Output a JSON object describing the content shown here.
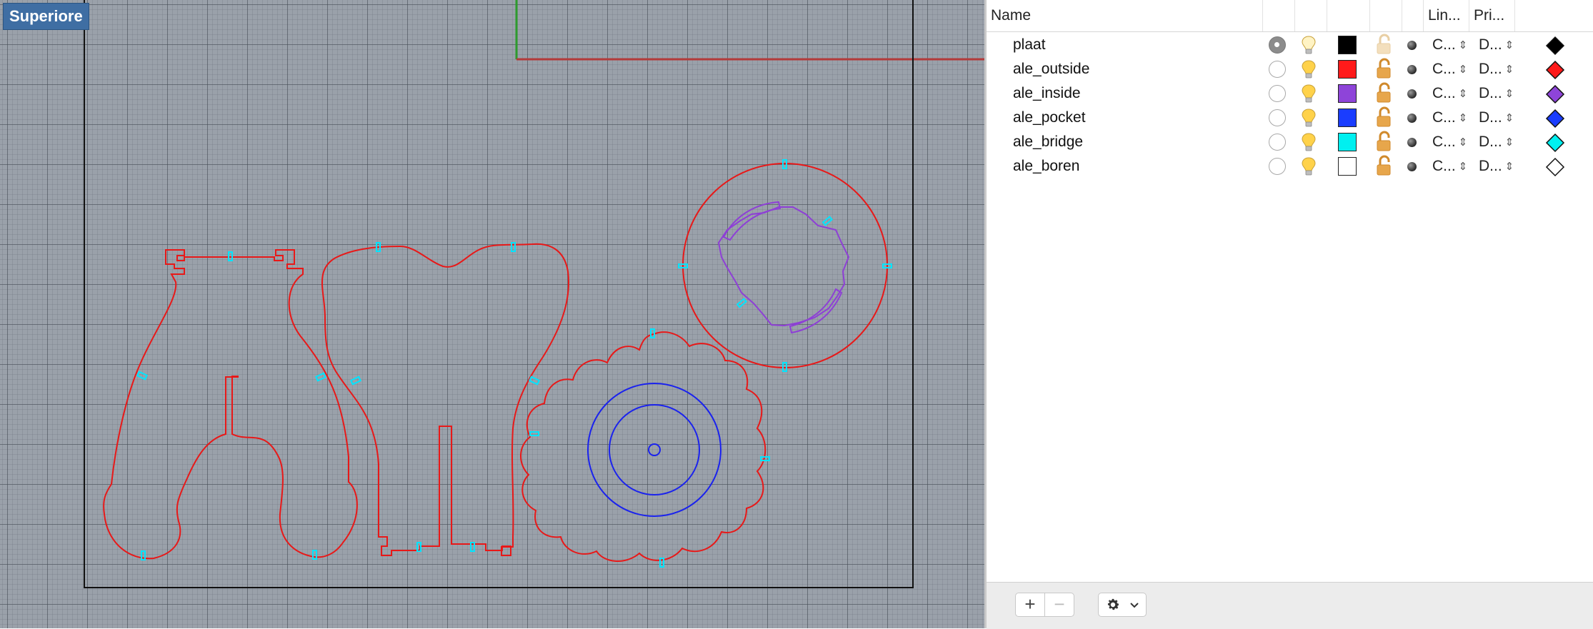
{
  "viewport": {
    "title": "Superiore"
  },
  "layers_panel": {
    "columns": {
      "name": "Name",
      "linetype": "Lin...",
      "print_width": "Pri..."
    },
    "layers": [
      {
        "name": "plaat",
        "current": true,
        "color": "#000000",
        "linetype": "C...",
        "print_width": "D...",
        "locked_faded": true
      },
      {
        "name": "ale_outside",
        "current": false,
        "color": "#ff1a1a",
        "linetype": "C...",
        "print_width": "D...",
        "locked_faded": false
      },
      {
        "name": "ale_inside",
        "current": false,
        "color": "#8e44d9",
        "linetype": "C...",
        "print_width": "D...",
        "locked_faded": false
      },
      {
        "name": "ale_pocket",
        "current": false,
        "color": "#1a3dff",
        "linetype": "C...",
        "print_width": "D...",
        "locked_faded": false
      },
      {
        "name": "ale_bridge",
        "current": false,
        "color": "#00f0f0",
        "linetype": "C...",
        "print_width": "D...",
        "locked_faded": false
      },
      {
        "name": "ale_boren",
        "current": false,
        "color": "#ffffff",
        "linetype": "C...",
        "print_width": "D...",
        "locked_faded": false
      }
    ],
    "bottom_bar": {
      "add_label": "+",
      "remove_label": "−",
      "gear_icon": "gear-icon",
      "chevron_icon": "chevron-down-icon"
    }
  }
}
